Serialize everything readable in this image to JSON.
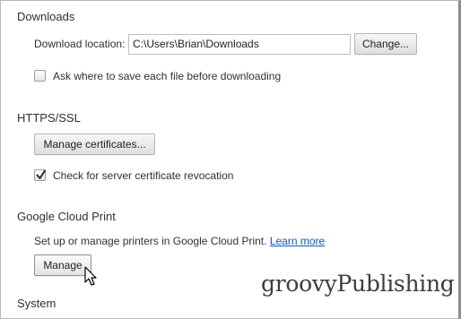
{
  "downloads": {
    "title": "Downloads",
    "location_label": "Download location:",
    "location_value": "C:\\Users\\Brian\\Downloads",
    "change_button": "Change...",
    "ask_label": "Ask where to save each file before downloading",
    "ask_checked": false
  },
  "https": {
    "title": "HTTPS/SSL",
    "manage_certs_button": "Manage certificates...",
    "revocation_label": "Check for server certificate revocation",
    "revocation_checked": true
  },
  "cloud_print": {
    "title": "Google Cloud Print",
    "description": "Set up or manage printers in Google Cloud Print.",
    "learn_more": "Learn more",
    "manage_button": "Manage"
  },
  "system": {
    "title": "System"
  },
  "watermark": {
    "text": "groovyPublishing"
  },
  "icons": {
    "checkmark": "check-icon",
    "cursor": "mouse-pointer-icon"
  },
  "colors": {
    "link": "#1155cc",
    "text": "#303030",
    "button_border": "#b5b5b5"
  }
}
